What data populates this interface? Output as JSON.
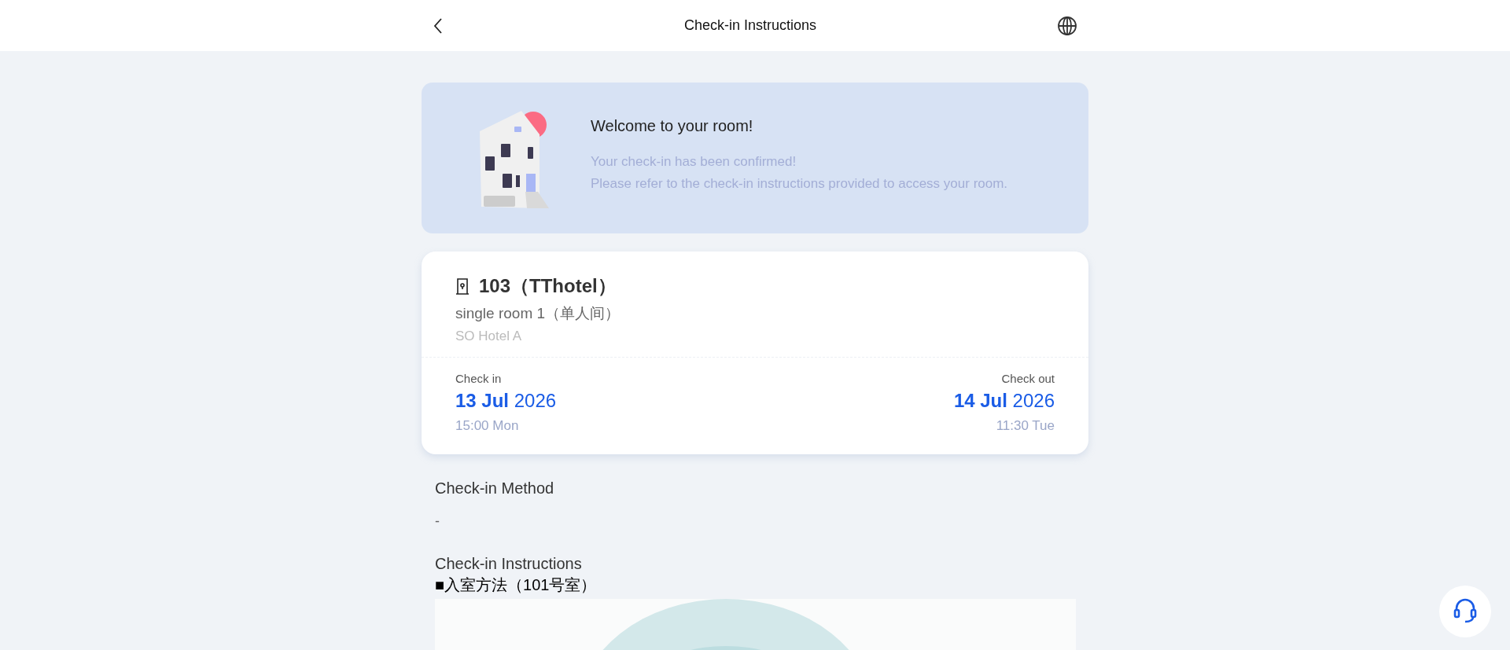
{
  "header": {
    "title": "Check-in Instructions"
  },
  "welcome": {
    "title": "Welcome to your room!",
    "lines": [
      "Your check-in has been confirmed!",
      "Please refer to the check-in instructions provided to access your room."
    ]
  },
  "room": {
    "title": "103（TThotel）",
    "type": "single room 1（单人间）",
    "hotel": "SO Hotel A"
  },
  "stay": [
    {
      "label": "Check in",
      "date": "**13 Jul** 2026",
      "time": "15:00 Mon"
    },
    {
      "label": "Check out",
      "date": "**14 Jul** 2026",
      "time": "11:30 Tue"
    }
  ],
  "sections": [
    {
      "heading": "Check-in Method",
      "value": "-"
    },
    {
      "heading": "Check-in Instructions",
      "blocks": [
        {
          "kind": "text",
          "text": "■入室方法（101号室）"
        },
        {
          "kind": "picture"
        }
      ]
    }
  ]
}
